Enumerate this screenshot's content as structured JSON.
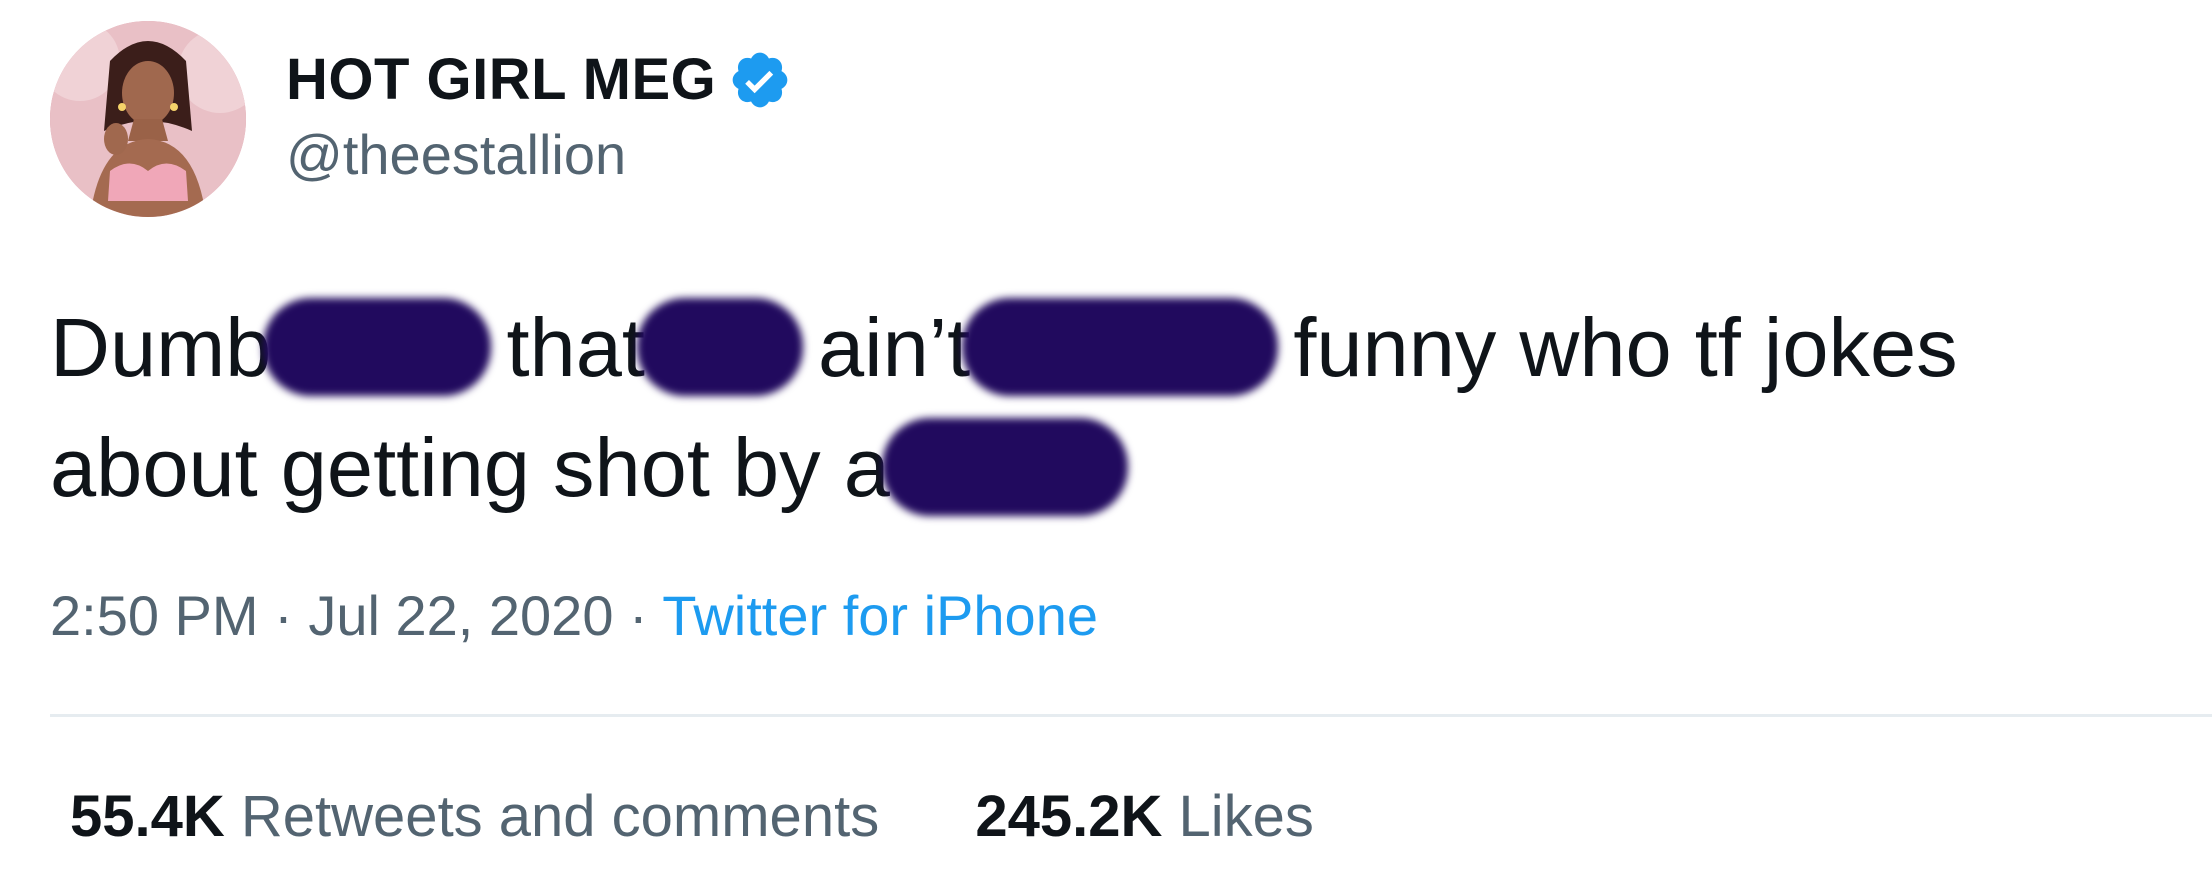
{
  "user": {
    "display_name": "HOT GIRL MEG",
    "handle": "@theestallion",
    "verified": true,
    "avatar_icon": "profile-photo",
    "verified_icon": "verified-badge-icon"
  },
  "tweet": {
    "line1": {
      "w1": "Dumb",
      "w2": "that",
      "w3": "ain’t",
      "w4": "funny who tf jokes"
    },
    "line2": {
      "w1": "about getting shot by a"
    },
    "redaction_color": "#210a5e"
  },
  "meta": {
    "time": "2:50 PM",
    "separator1": " · ",
    "date": "Jul 22, 2020",
    "separator2": " · ",
    "source": "Twitter for iPhone"
  },
  "stats": {
    "retweets_count": "55.4K",
    "retweets_label": "Retweets and comments",
    "likes_count": "245.2K",
    "likes_label": "Likes"
  },
  "colors": {
    "text": "#0f1419",
    "secondary": "#536471",
    "link": "#1d9bf0",
    "divider": "#e6ecf0"
  }
}
